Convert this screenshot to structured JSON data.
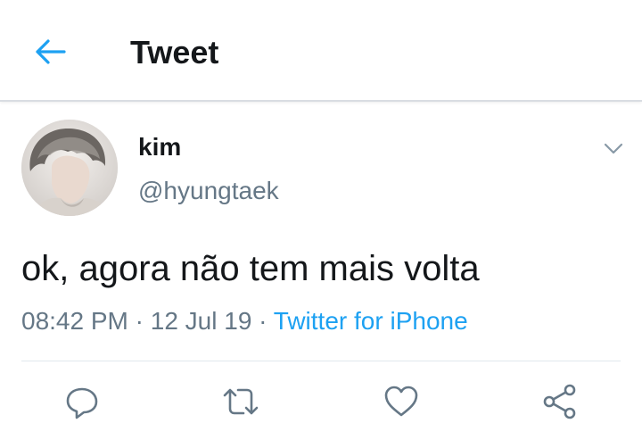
{
  "header": {
    "back_icon": "arrow-left-icon",
    "title": "Tweet"
  },
  "tweet": {
    "author": {
      "display_name": "kim",
      "handle": "@hyungtaek"
    },
    "menu_icon": "chevron-down-icon",
    "text": "ok, agora não tem mais volta",
    "time": "08:42 PM",
    "separator": "·",
    "date": "12 Jul 19",
    "source": "Twitter for iPhone"
  },
  "actions": {
    "reply_icon": "reply-icon",
    "retweet_icon": "retweet-icon",
    "like_icon": "heart-icon",
    "share_icon": "share-icon"
  },
  "colors": {
    "accent": "#1da1f2",
    "text_primary": "#14171a",
    "text_secondary": "#657786",
    "icon_gray": "#657786",
    "divider": "#e1e8ed"
  }
}
